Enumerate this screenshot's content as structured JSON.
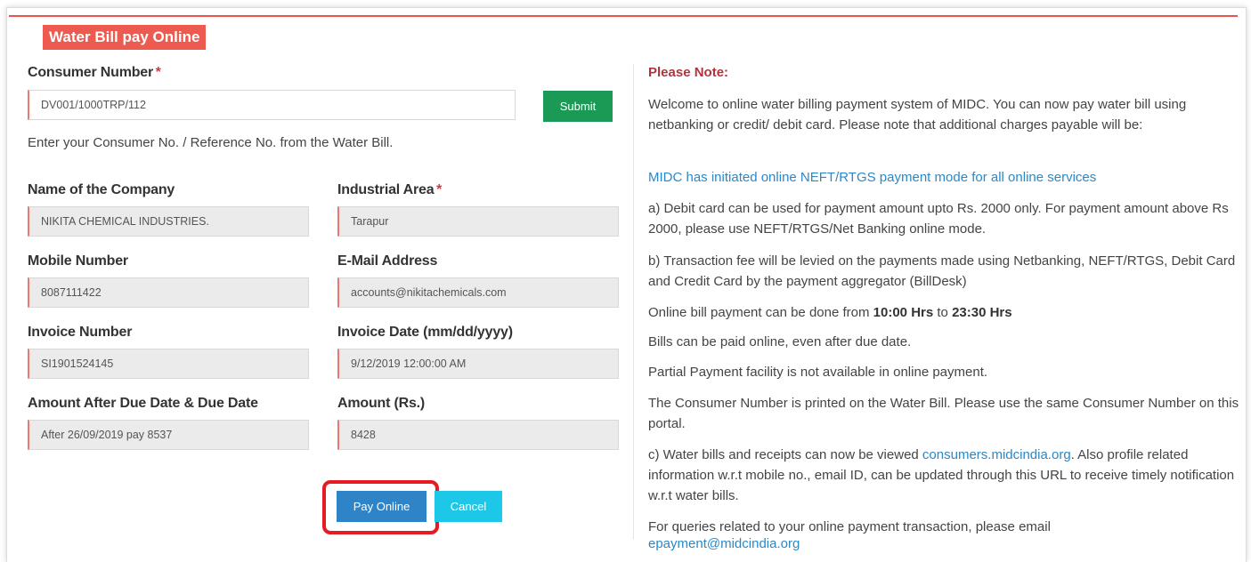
{
  "form": {
    "title": "Water Bill pay Online",
    "consumer_number": {
      "label": "Consumer Number",
      "required_mark": "*",
      "value": "DV001/1000TRP/112"
    },
    "submit_label": "Submit",
    "hint": "Enter your Consumer No. / Reference No. from the Water Bill.",
    "company": {
      "label": "Name of the Company",
      "value": "NIKITA CHEMICAL INDUSTRIES."
    },
    "industrial_area": {
      "label": "Industrial Area",
      "required_mark": "*",
      "value": "Tarapur"
    },
    "mobile": {
      "label": "Mobile Number",
      "value": "8087111422"
    },
    "email": {
      "label": "E-Mail Address",
      "value": "accounts@nikitachemicals.com"
    },
    "invoice_number": {
      "label": "Invoice Number",
      "value": "SI1901524145"
    },
    "invoice_date": {
      "label": "Invoice Date (mm/dd/yyyy)",
      "value": "9/12/2019 12:00:00 AM"
    },
    "amount_after_due": {
      "label": "Amount After Due Date & Due Date",
      "value": "After 26/09/2019 pay 8537"
    },
    "amount": {
      "label": "Amount (Rs.)",
      "value": "8428"
    },
    "pay_label": "Pay Online",
    "cancel_label": "Cancel"
  },
  "note": {
    "title": "Please Note:",
    "welcome": "Welcome to online water billing payment system of MIDC. You can now pay water bill using netbanking or credit/ debit card. Please note that additional charges payable will be:",
    "neft_notice": "MIDC has initiated online NEFT/RTGS payment mode for all online services",
    "point_a": "a) Debit card can be used for payment amount upto Rs. 2000 only. For payment amount above Rs 2000, please use NEFT/RTGS/Net Banking online mode.",
    "point_b": "b) Transaction fee will be levied on the payments made using Netbanking, NEFT/RTGS, Debit Card and Credit Card by the payment aggregator (BillDesk)",
    "timing_prefix": "Online bill payment can be done from ",
    "timing_from": "10:00 Hrs",
    "timing_mid": " to ",
    "timing_to": "23:30 Hrs",
    "after_due": "Bills can be paid online, even after due date.",
    "partial": "Partial Payment facility is not available in online payment.",
    "consumer_info": "The Consumer Number is printed on the Water Bill. Please use the same Consumer Number on this portal.",
    "point_c_prefix": "c) Water bills and receipts can now be viewed ",
    "point_c_link": "consumers.midcindia.org",
    "point_c_suffix": ". Also profile related information w.r.t mobile no., email ID, can be updated through this URL to receive timely notification w.r.t water bills.",
    "queries": "For queries related to your online payment transaction, please email",
    "support_email": "epayment@midcindia.org"
  },
  "colors": {
    "accent": "#ec5a50",
    "submit": "#1a9a55",
    "pay": "#2e84c6",
    "cancel": "#1dc7e8",
    "link": "#2a88c8",
    "highlight": "#e81a23"
  }
}
